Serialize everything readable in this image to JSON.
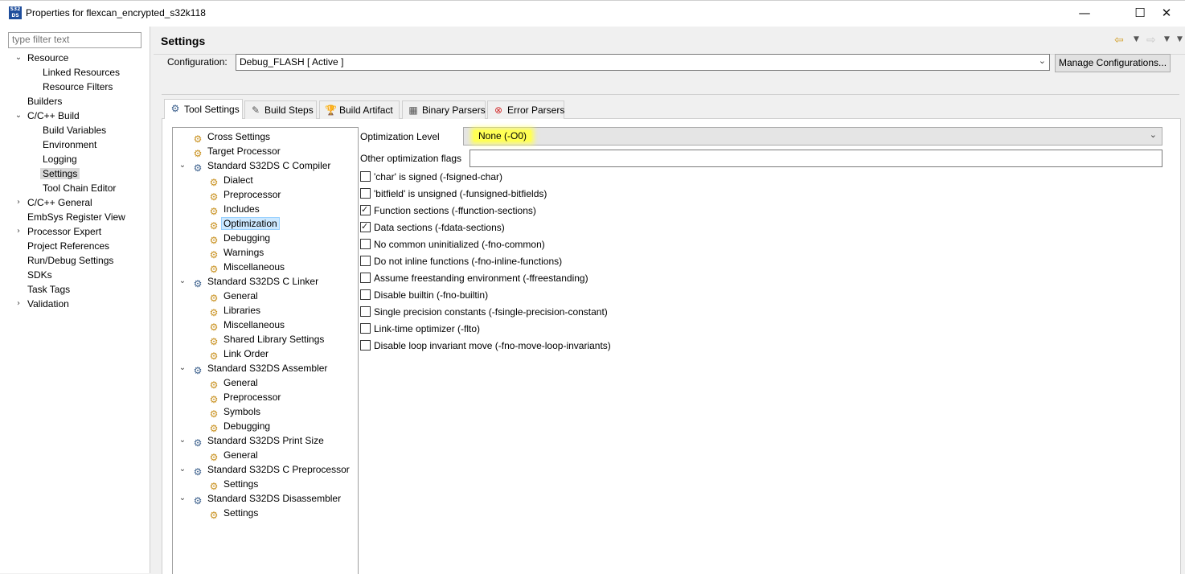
{
  "window": {
    "title": "Properties for flexcan_encrypted_s32k118",
    "app_icon": "S32 DS",
    "minimize": "—",
    "maximize": "☐",
    "close": "✕"
  },
  "filter": {
    "placeholder": "type filter text"
  },
  "nav": [
    {
      "label": "Resource",
      "expanded": true
    },
    {
      "label": "Linked Resources"
    },
    {
      "label": "Resource Filters"
    },
    {
      "label": "Builders"
    },
    {
      "label": "C/C++ Build",
      "expanded": true
    },
    {
      "label": "Build Variables"
    },
    {
      "label": "Environment"
    },
    {
      "label": "Logging"
    },
    {
      "label": "Settings",
      "selected": true
    },
    {
      "label": "Tool Chain Editor"
    },
    {
      "label": "C/C++ General",
      "expanded": false
    },
    {
      "label": "EmbSys Register View"
    },
    {
      "label": "Processor Expert",
      "expanded": false
    },
    {
      "label": "Project References"
    },
    {
      "label": "Run/Debug Settings"
    },
    {
      "label": "SDKs"
    },
    {
      "label": "Task Tags"
    },
    {
      "label": "Validation",
      "expanded": false
    }
  ],
  "header": {
    "title": "Settings"
  },
  "configuration": {
    "label": "Configuration:",
    "value": "Debug_FLASH  [ Active ]",
    "manage_button": "Manage Configurations..."
  },
  "tabs": [
    {
      "label": "Tool Settings",
      "active": true,
      "icon": "tool-settings-icon"
    },
    {
      "label": "Build Steps",
      "icon": "build-steps-icon"
    },
    {
      "label": "Build Artifact",
      "icon": "build-artifact-icon"
    },
    {
      "label": "Binary Parsers",
      "icon": "binary-parsers-icon"
    },
    {
      "label": "Error Parsers",
      "icon": "error-parsers-icon"
    }
  ],
  "tree": [
    {
      "label": "Cross Settings"
    },
    {
      "label": "Target Processor"
    },
    {
      "label": "Standard S32DS C Compiler"
    },
    {
      "label": "Dialect"
    },
    {
      "label": "Preprocessor"
    },
    {
      "label": "Includes"
    },
    {
      "label": "Optimization",
      "selected": true
    },
    {
      "label": "Debugging"
    },
    {
      "label": "Warnings"
    },
    {
      "label": "Miscellaneous"
    },
    {
      "label": "Standard S32DS C Linker"
    },
    {
      "label": "General"
    },
    {
      "label": "Libraries"
    },
    {
      "label": "Miscellaneous"
    },
    {
      "label": "Shared Library Settings"
    },
    {
      "label": "Link Order"
    },
    {
      "label": "Standard S32DS Assembler"
    },
    {
      "label": "General"
    },
    {
      "label": "Preprocessor"
    },
    {
      "label": "Symbols"
    },
    {
      "label": "Debugging"
    },
    {
      "label": "Standard S32DS Print Size"
    },
    {
      "label": "General"
    },
    {
      "label": "Standard S32DS C Preprocessor"
    },
    {
      "label": "Settings"
    },
    {
      "label": "Standard S32DS Disassembler"
    },
    {
      "label": "Settings"
    }
  ],
  "optimization": {
    "level_label": "Optimization Level",
    "level_value": "None (-O0)",
    "highlight_color": "#ffff55",
    "flags_label": "Other optimization flags",
    "flags_value": ""
  },
  "options": [
    {
      "label": "'char' is signed (-fsigned-char)",
      "checked": false
    },
    {
      "label": "'bitfield' is unsigned (-funsigned-bitfields)",
      "checked": false
    },
    {
      "label": "Function sections (-ffunction-sections)",
      "checked": true
    },
    {
      "label": "Data sections (-fdata-sections)",
      "checked": true
    },
    {
      "label": "No common uninitialized (-fno-common)",
      "checked": false
    },
    {
      "label": "Do not inline functions (-fno-inline-functions)",
      "checked": false
    },
    {
      "label": "Assume freestanding environment (-ffreestanding)",
      "checked": false
    },
    {
      "label": "Disable builtin (-fno-builtin)",
      "checked": false
    },
    {
      "label": "Single precision constants (-fsingle-precision-constant)",
      "checked": false
    },
    {
      "label": "Link-time optimizer (-flto)",
      "checked": false
    },
    {
      "label": "Disable loop invariant move (-fno-move-loop-invariants)",
      "checked": false
    }
  ]
}
